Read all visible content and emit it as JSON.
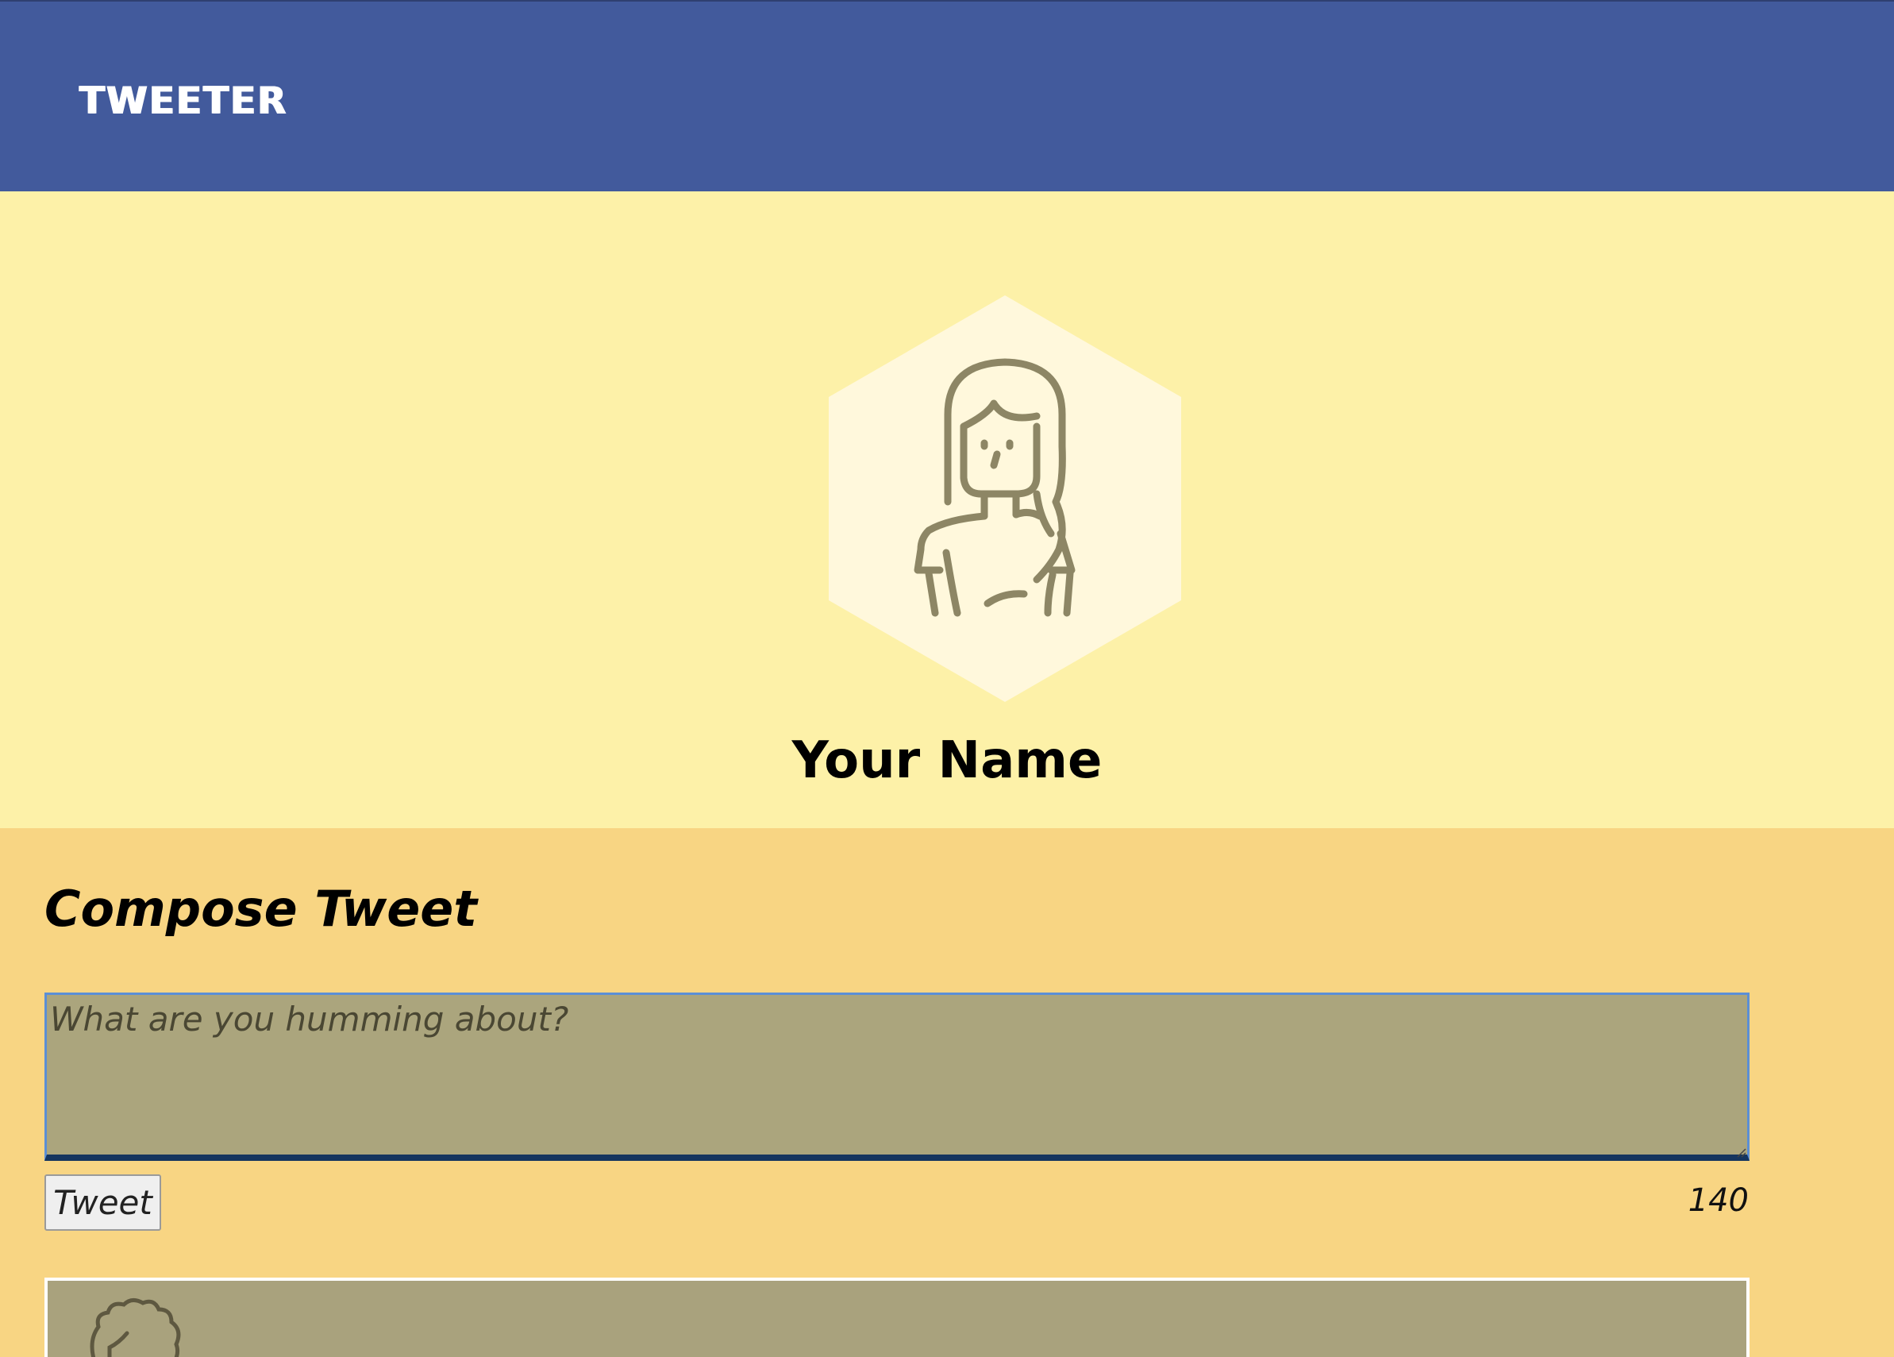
{
  "navbar": {
    "brand": "TWEETER",
    "background": "#425a9c"
  },
  "profile": {
    "avatar_icon": "woman-avatar-icon",
    "name": "Your Name",
    "background": "#fdf1a8"
  },
  "compose": {
    "title": "Compose Tweet",
    "placeholder": "What are you humming about?",
    "value": "",
    "submit_label": "Tweet",
    "char_counter": "140",
    "background": "#f8d583"
  },
  "tweets": [
    {
      "avatar_icon": "curly-hair-avatar-icon"
    }
  ]
}
